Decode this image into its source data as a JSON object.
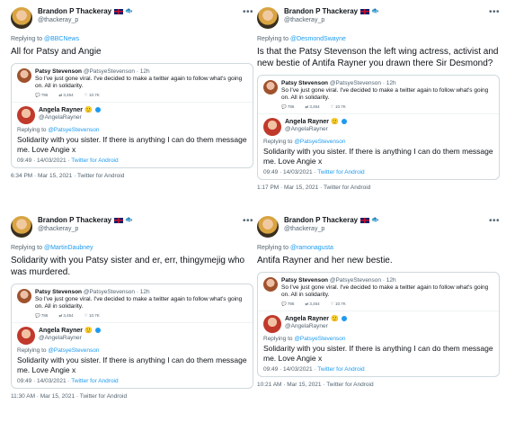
{
  "author": {
    "name": "Brandon P Thackeray",
    "handle": "@thackeray_p"
  },
  "more_glyph": "•••",
  "replying_prefix": "Replying to ",
  "quoted": {
    "patsy_name": "Patsy Stevenson",
    "patsy_handle_time": "@PatsyeStevenson · 12h",
    "patsy_text": "So I've just gone viral. I've decided to make a twitter again to follow what's going on. All in solidarity.",
    "patsy_stats": [
      "786",
      "3,454",
      "10.7K"
    ],
    "angela_name": "Angela Rayner",
    "angela_emoji": "🙂",
    "angela_handle": "@AngelaRayner",
    "angela_reply_prefix": "Replying to ",
    "angela_reply_to": "@PatsyeStevenson",
    "angela_text": "Solidarity with you sister. If there is anything I can do them message me. Love Angie x",
    "angela_meta_time": "09:49 · 14/03/2021 · ",
    "angela_meta_app": "Twitter for Android"
  },
  "tweets": [
    {
      "replying_to": "@BBCNews",
      "text": "All for Patsy and Angie",
      "footer": "6:34 PM · Mar 15, 2021 · Twitter for Android"
    },
    {
      "replying_to": "@DesmondSwayne",
      "text": "Is that the Patsy Stevenson the left wing actress, activist and new bestie of Antifa Rayner you drawn there Sir Desmond?",
      "footer": "1:17 PM · Mar 15, 2021 · Twitter for Android"
    },
    {
      "replying_to": "@MartinDaubney",
      "text": "Solidarity with you Patsy sister and er, err, thingymejig who was murdered.",
      "footer": "11:30 AM · Mar 15, 2021 · Twitter for Android"
    },
    {
      "replying_to": "@ramonagusta",
      "text": "Antifa Rayner and her new bestie.",
      "footer": "10:21 AM · Mar 15, 2021 · Twitter for Android"
    }
  ],
  "colors": {
    "link": "#1d9bf0",
    "muted": "#536471",
    "text": "#0f1419",
    "border": "#cfd9de"
  }
}
